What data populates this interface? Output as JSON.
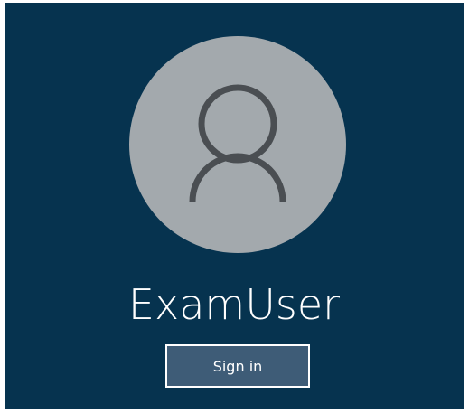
{
  "login": {
    "username": "ExamUser",
    "sign_in_label": "Sign in",
    "avatar_icon": "user-silhouette-icon"
  },
  "colors": {
    "background": "#06334f",
    "avatar_circle": "#a3a9ad",
    "avatar_glyph": "#4a4e52",
    "button_fill": "#3e5c77",
    "button_border": "#ffffff",
    "text": "#ffffff"
  }
}
